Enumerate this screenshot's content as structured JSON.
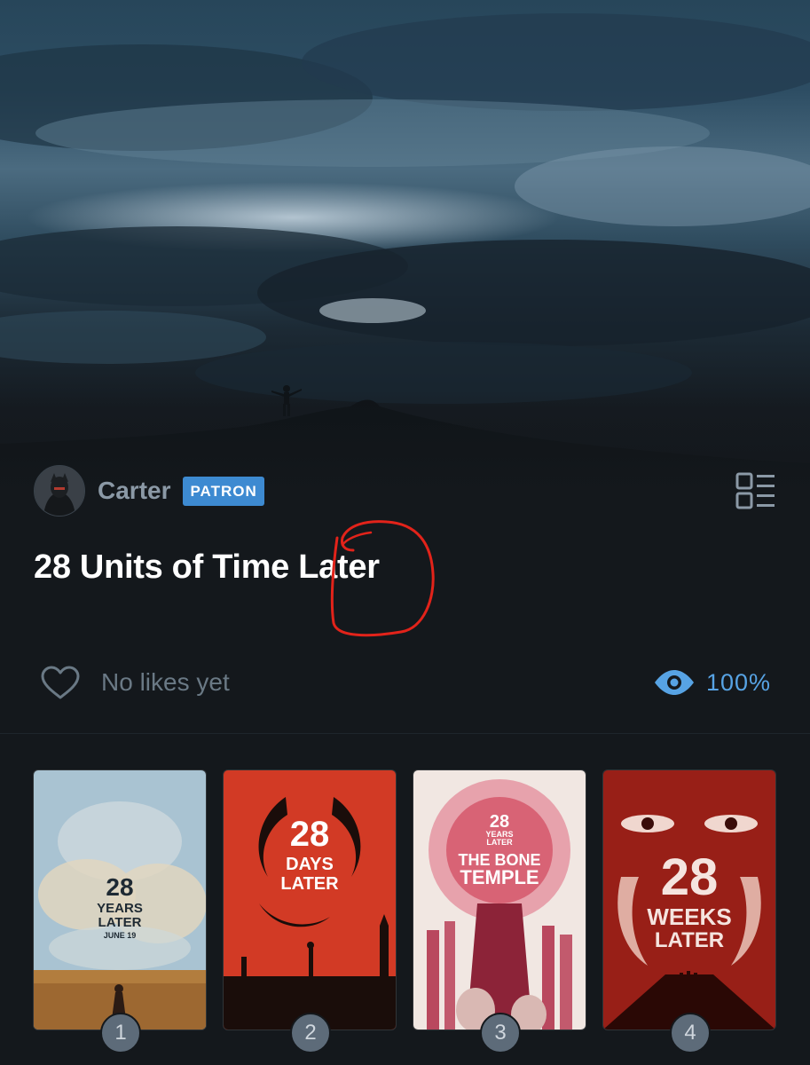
{
  "author": {
    "name": "Carter",
    "badge": "PATRON"
  },
  "list": {
    "title": "28 Units of Time Later"
  },
  "stats": {
    "likes_text": "No likes yet",
    "views_text": "100%"
  },
  "icons": {
    "list_view_toggle": "list-view-icon",
    "like": "heart-icon",
    "views": "eye-icon"
  },
  "colors": {
    "background": "#14181c",
    "badge": "#3d8ad1",
    "accent_blue": "#57a3e4",
    "annotation_red": "#e2231a"
  },
  "posters": [
    {
      "rank": "1",
      "title_line1": "28",
      "title_line2": "YEARS",
      "title_line3": "LATER",
      "date": "JUNE 19"
    },
    {
      "rank": "2",
      "title_line1": "28",
      "title_line2": "DAYS",
      "title_line3": "LATER"
    },
    {
      "rank": "3",
      "title_line1": "28",
      "title_line2": "YEARS",
      "title_line3": "LATER",
      "subtitle_line1": "THE BONE",
      "subtitle_line2": "TEMPLE"
    },
    {
      "rank": "4",
      "title_line1": "28",
      "title_line2": "WEEKS",
      "title_line3": "LATER"
    }
  ]
}
